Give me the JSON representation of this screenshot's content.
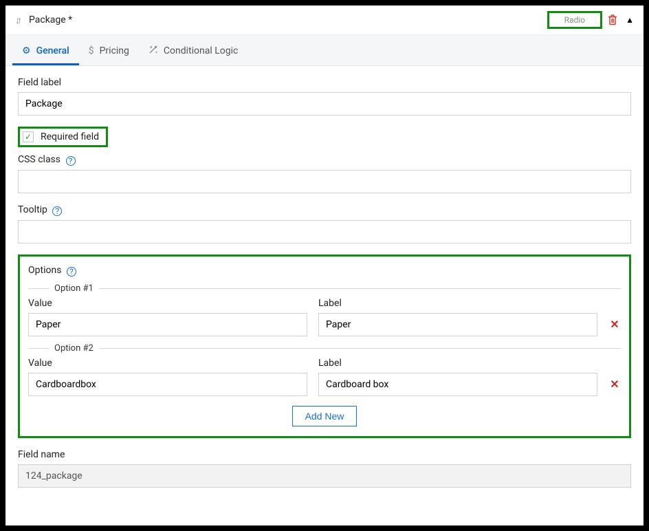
{
  "header": {
    "title": "Package *",
    "type": "Radio"
  },
  "tabs": {
    "general": "General",
    "pricing": "Pricing",
    "conditional": "Conditional Logic"
  },
  "labels": {
    "field_label": "Field label",
    "required": "Required field",
    "css_class": "CSS class",
    "tooltip": "Tooltip",
    "options": "Options",
    "value": "Value",
    "label": "Label",
    "add_new": "Add New",
    "field_name": "Field name"
  },
  "values": {
    "field_label": "Package",
    "css_class": "",
    "tooltip": "",
    "field_name": "124_package"
  },
  "options": [
    {
      "legend": "Option #1",
      "value": "Paper",
      "label": "Paper"
    },
    {
      "legend": "Option #2",
      "value": "Cardboardbox",
      "label": "Cardboard box"
    }
  ]
}
